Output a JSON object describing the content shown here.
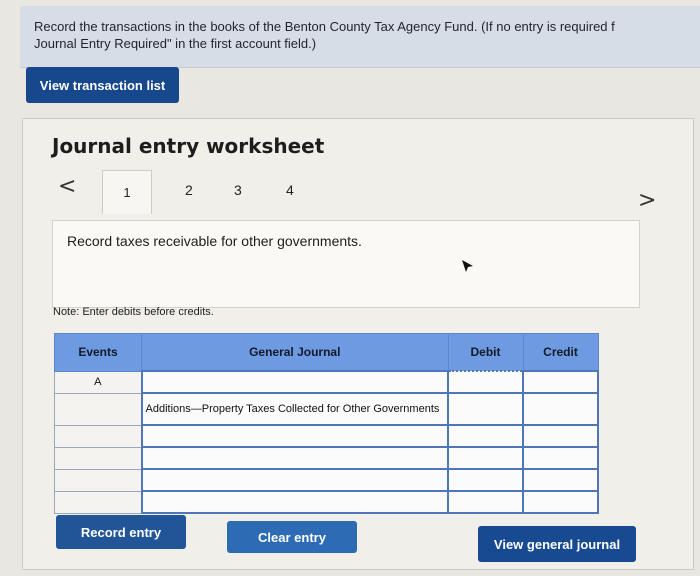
{
  "instructions": {
    "line1": "Record the transactions in the books of the Benton County Tax Agency Fund. (If no entry is required f",
    "line2": "Journal Entry Required\" in the first account field.)"
  },
  "buttons": {
    "view_transaction_list": "View transaction list",
    "record_entry": "Record entry",
    "clear_entry": "Clear entry",
    "view_general_journal": "View general journal"
  },
  "worksheet": {
    "title": "Journal entry worksheet",
    "prev_arrow": "<",
    "next_arrow": ">",
    "tabs": [
      "1",
      "2",
      "3",
      "4"
    ],
    "active_tab": "1",
    "description": "Record taxes receivable for other governments.",
    "note": "Note: Enter debits before credits."
  },
  "journal_table": {
    "headers": {
      "events": "Events",
      "general_journal": "General Journal",
      "debit": "Debit",
      "credit": "Credit"
    },
    "rows": [
      {
        "event": "A",
        "account": "",
        "debit": "",
        "credit": ""
      },
      {
        "event": "",
        "account": "Additions—Property Taxes Collected for Other Governments",
        "debit": "",
        "credit": ""
      },
      {
        "event": "",
        "account": "",
        "debit": "",
        "credit": ""
      },
      {
        "event": "",
        "account": "",
        "debit": "",
        "credit": ""
      },
      {
        "event": "",
        "account": "",
        "debit": "",
        "credit": ""
      },
      {
        "event": "",
        "account": "",
        "debit": "",
        "credit": ""
      }
    ]
  },
  "icons": {
    "cursor": "mouse-pointer-icon"
  }
}
